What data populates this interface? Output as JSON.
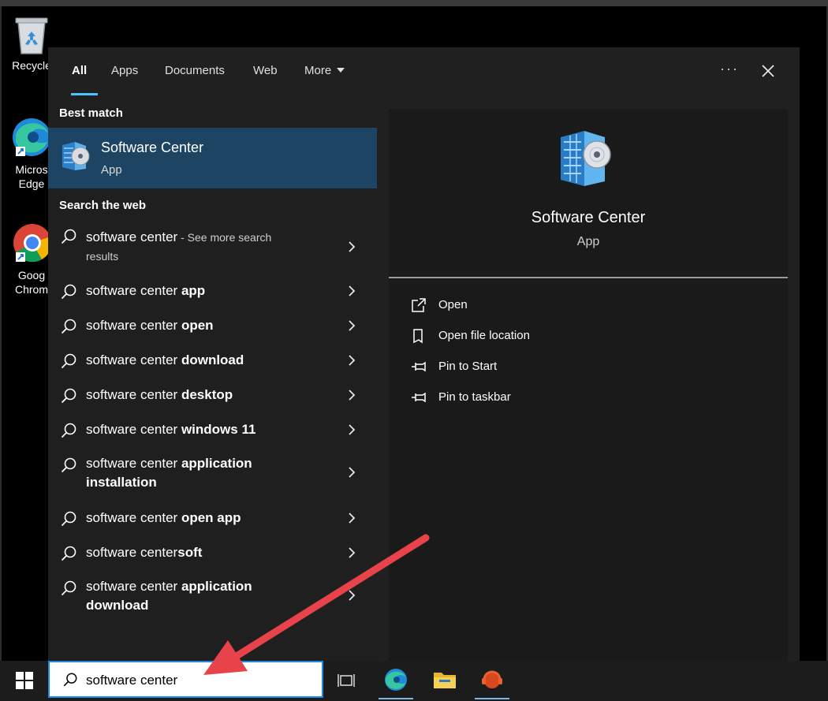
{
  "desktop": {
    "icons": [
      {
        "label_1": "Recycle",
        "label_2": "",
        "icon": "recycle-bin-icon"
      },
      {
        "label_1": "Micros",
        "label_2": "Edge",
        "icon": "edge-icon"
      },
      {
        "label_1": "Goog",
        "label_2": "Chrom",
        "icon": "chrome-icon"
      }
    ]
  },
  "tabs": {
    "all": "All",
    "apps": "Apps",
    "documents": "Documents",
    "web": "Web",
    "more": "More",
    "ellipsis": "···"
  },
  "best_match": {
    "section_title": "Best match",
    "name": "Software Center",
    "type": "App",
    "icon": "software-center-icon"
  },
  "web_search": {
    "section_title": "Search the web",
    "items": [
      {
        "plain": "software center",
        "bold": "",
        "suffix": " - See more search",
        "suffix2": "results"
      },
      {
        "plain": "software center ",
        "bold": "app"
      },
      {
        "plain": "software center ",
        "bold": "open"
      },
      {
        "plain": "software center ",
        "bold": "download"
      },
      {
        "plain": "software center ",
        "bold": "desktop"
      },
      {
        "plain": "software center ",
        "bold": "windows 11"
      },
      {
        "plain": "software center ",
        "bold": "application",
        "bold2": "installation"
      },
      {
        "plain": "software center ",
        "bold": "open app"
      },
      {
        "plain": "software center",
        "bold": "soft"
      },
      {
        "plain": "software center ",
        "bold": "application",
        "bold2": "download"
      }
    ]
  },
  "details": {
    "title": "Software Center",
    "subtitle": "App",
    "actions": [
      {
        "label": "Open",
        "icon": "open-icon"
      },
      {
        "label": "Open file location",
        "icon": "file-location-icon"
      },
      {
        "label": "Pin to Start",
        "icon": "pin-icon"
      },
      {
        "label": "Pin to taskbar",
        "icon": "pin-icon"
      }
    ]
  },
  "taskbar": {
    "search_value": "software center",
    "items": [
      "task-view-icon",
      "edge-icon",
      "file-explorer-icon",
      "support-headset-icon"
    ]
  },
  "colors": {
    "accent": "#4cc2ff",
    "selection": "#1d4563",
    "annotation_arrow": "#e8424a"
  }
}
